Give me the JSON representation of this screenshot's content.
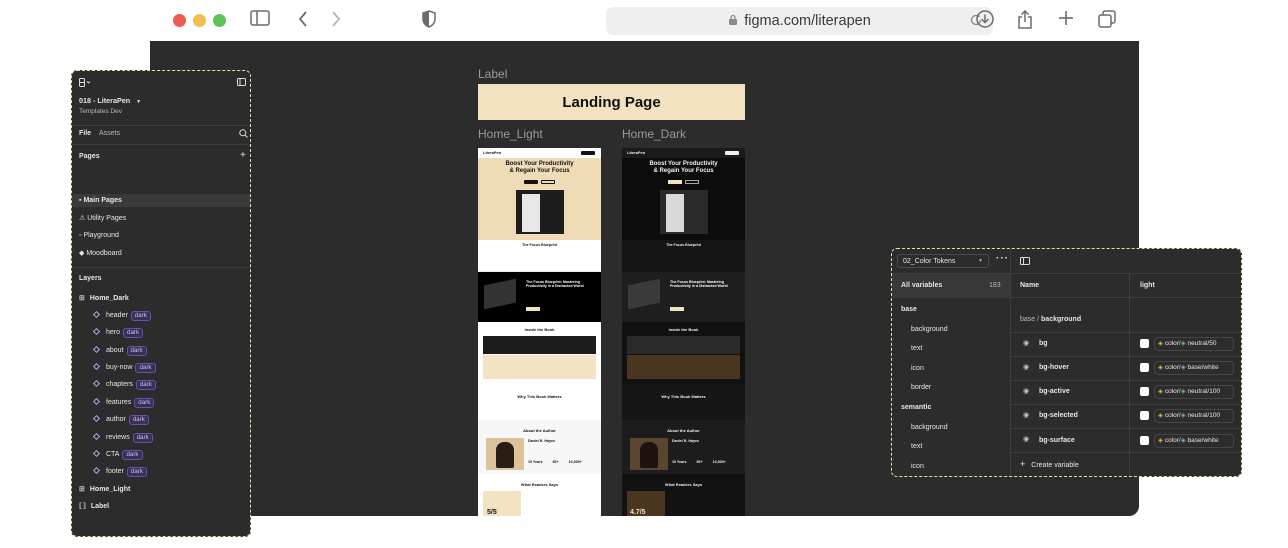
{
  "browser": {
    "url": "figma.com/literapen"
  },
  "canvas": {
    "label_caption": "Label",
    "landing_title": "Landing Page",
    "home_light_caption": "Home_Light",
    "home_dark_caption": "Home_Dark"
  },
  "left_panel": {
    "file_name": "018 - LiteraPen",
    "team": "Templates Dev",
    "tabs": [
      "File",
      "Assets"
    ],
    "pages_title": "Pages",
    "pages": [
      "Main Pages",
      "Utility Pages",
      "Playground",
      "Moodboard"
    ],
    "layers_title": "Layers",
    "root_layer": "Home_Dark",
    "layers": [
      {
        "name": "header",
        "tag": "dark"
      },
      {
        "name": "hero",
        "tag": "dark"
      },
      {
        "name": "about",
        "tag": "dark"
      },
      {
        "name": "buy-now",
        "tag": "dark"
      },
      {
        "name": "chapters",
        "tag": "dark"
      },
      {
        "name": "features",
        "tag": "dark"
      },
      {
        "name": "author",
        "tag": "dark"
      },
      {
        "name": "reviews",
        "tag": "dark"
      },
      {
        "name": "CTA",
        "tag": "dark"
      },
      {
        "name": "footer",
        "tag": "dark"
      }
    ],
    "other_layers": [
      "Home_Light",
      "Label"
    ]
  },
  "mockup": {
    "logo": "LiteraPen",
    "hero_title_1": "Boost Your Productivity",
    "hero_title_2": "& Regain Your Focus",
    "book_title": "The Focus Blueprint",
    "about_title": "The Focus Blueprint",
    "buy_title": "The Focus Blueprint: Mastering Productivity in a Distracted World",
    "inside_title": "Inside the Book",
    "why_title": "Why This Book Matters",
    "author_section_title": "About the Author",
    "author_name": "Daniel R. Hayes",
    "stats": [
      "10 Years",
      "50+",
      "10,000+"
    ],
    "reviews_title": "What Readers Says",
    "rating_light": "5/5",
    "rating_dark": "4.7/5"
  },
  "tokens_panel": {
    "collection": "02_Color Tokens",
    "all_variables": "All variables",
    "count": "183",
    "col_name": "Name",
    "col_mode": "light",
    "groups": [
      {
        "name": "base",
        "children": [
          "background",
          "text",
          "icon",
          "border"
        ]
      },
      {
        "name": "semantic",
        "children": [
          "background",
          "text",
          "icon"
        ]
      }
    ],
    "path_prefix": "base /",
    "path_current": "background",
    "rows": [
      {
        "name": "bg",
        "value": "color/",
        "alias": "neutral/50"
      },
      {
        "name": "bg-hover",
        "value": "color/",
        "alias": "base/white"
      },
      {
        "name": "bg-active",
        "value": "color/",
        "alias": "neutral/100"
      },
      {
        "name": "bg-selected",
        "value": "color/",
        "alias": "neutral/100"
      },
      {
        "name": "bg-surface",
        "value": "color/",
        "alias": "base/white"
      }
    ],
    "create_label": "Create variable"
  },
  "colors": {
    "canvas": "#2c2c2c",
    "panel_border": "#e8e2a8",
    "landing_bg": "#f2e2c0",
    "layer_tag": "#3a2f55"
  }
}
